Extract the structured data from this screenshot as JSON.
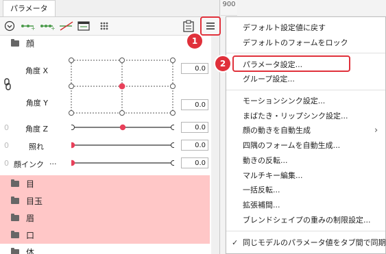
{
  "panel": {
    "tab_label": "パラメータ",
    "groups": [
      {
        "label": "顔"
      },
      {
        "label": "目"
      },
      {
        "label": "目玉"
      },
      {
        "label": "眉"
      },
      {
        "label": "口"
      },
      {
        "label": "体"
      }
    ],
    "params": {
      "angle_x": {
        "label": "角度 X",
        "value": "0.0"
      },
      "angle_y": {
        "label": "角度 Y",
        "value": "0.0"
      },
      "angle_z": {
        "label": "角度 Z",
        "value": "0.0",
        "level": 0.5
      },
      "blush": {
        "label": "照れ",
        "value": "0.0",
        "level": 0.0
      },
      "face_ink": {
        "label": "顔インク",
        "ellipsis": "...",
        "value": "0.0",
        "level": 0.0
      }
    }
  },
  "ruler": {
    "value": "900"
  },
  "menu": {
    "items": [
      {
        "label": "デフォルト設定値に戻す"
      },
      {
        "label": "デフォルトのフォームをロック"
      },
      {
        "label": "パラメータ設定..."
      },
      {
        "label": "グループ設定..."
      },
      {
        "label": "モーションシンク設定..."
      },
      {
        "label": "まばたき・リップシンク設定..."
      },
      {
        "label": "顔の動きを自動生成"
      },
      {
        "label": "四隅のフォームを自動生成..."
      },
      {
        "label": "動きの反転..."
      },
      {
        "label": "マルチキー編集..."
      },
      {
        "label": "一括反転..."
      },
      {
        "label": "拡張補間..."
      },
      {
        "label": "ブレンドシェイプの重みの制限設定..."
      },
      {
        "label": "同じモデルのパラメータ値をタブ間で同期"
      }
    ],
    "checkmark": "✓",
    "submenu_arrow": "›"
  },
  "annotations": {
    "badge1": "1",
    "badge2": "2"
  },
  "colors": {
    "accent_red": "#e0303a",
    "highlight_pink": "#ffc7c7",
    "knob": "#e8405a",
    "toolbar_green": "#4a9a4a"
  }
}
